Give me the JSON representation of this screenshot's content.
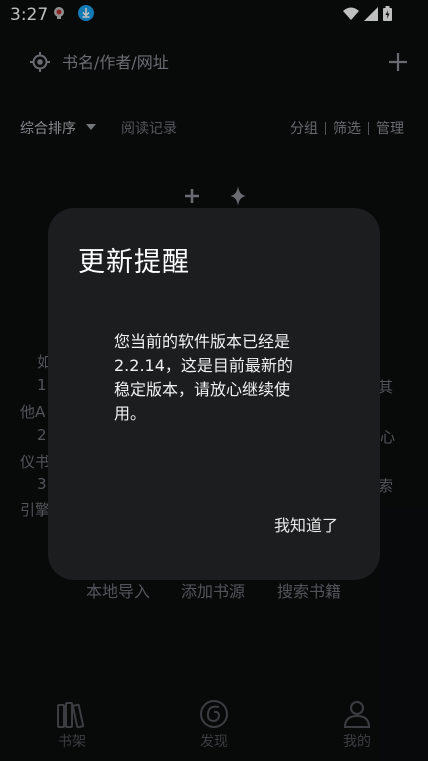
{
  "status_bar": {
    "time": "3:27"
  },
  "search": {
    "placeholder": "书名/作者/网址"
  },
  "toolbar": {
    "sort_label": "综合排序",
    "history_label": "阅读记录",
    "group_label": "分组",
    "filter_label": "筛选",
    "manage_label": "管理"
  },
  "background_hints": {
    "line1_left": "如",
    "line2_left": "1",
    "line2_right": "其",
    "line3_left": "他A",
    "line4_left": "2",
    "line4_right": "心",
    "line5_left": "仪书",
    "line6_left": "3",
    "line6_right": "索",
    "line7_left": "引擎"
  },
  "quick_actions": [
    {
      "label": "本地导入"
    },
    {
      "label": "添加书源"
    },
    {
      "label": "搜索书籍"
    }
  ],
  "bottom_nav": [
    {
      "label": "书架",
      "icon": "bookshelf-icon"
    },
    {
      "label": "发现",
      "icon": "discover-icon"
    },
    {
      "label": "我的",
      "icon": "profile-icon"
    }
  ],
  "dialog": {
    "title": "更新提醒",
    "message": "您当前的软件版本已经是\n2.2.14，这是目前最新的\n稳定版本，请放心继续使\n用。",
    "button_label": "我知道了"
  },
  "colors": {
    "background": "#0b0c0d",
    "dialog_bg": "#1b1d1f",
    "download_notification": "#1aa3f2"
  }
}
